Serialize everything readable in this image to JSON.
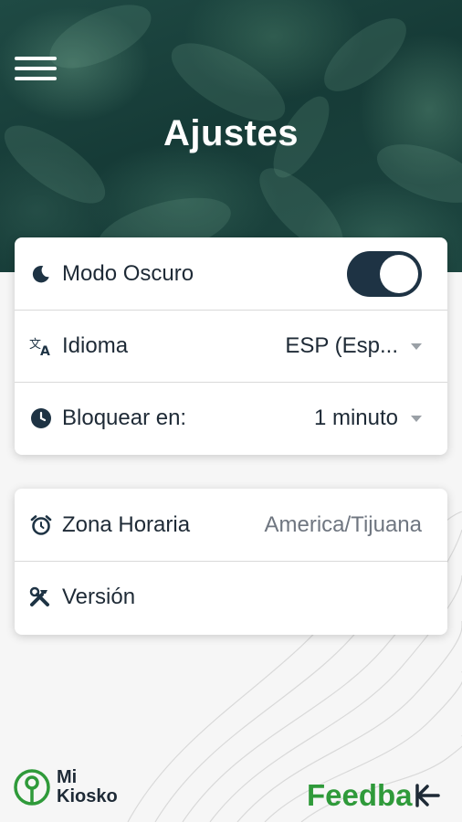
{
  "header": {
    "title": "Ajustes"
  },
  "settings_card": {
    "dark_mode": {
      "label": "Modo Oscuro",
      "enabled": true
    },
    "language": {
      "label": "Idioma",
      "value": "ESP (Esp..."
    },
    "lock": {
      "label": "Bloquear en:",
      "value": "1 minuto"
    }
  },
  "info_card": {
    "timezone": {
      "label": "Zona Horaria",
      "value": "America/Tijuana"
    },
    "version": {
      "label": "Versión",
      "value": ""
    }
  },
  "footer": {
    "logo_line1": "Mi",
    "logo_line2": "Kiosko",
    "feedback_label": "Feedba"
  },
  "colors": {
    "primary_dark": "#1e3344",
    "feedback_green": "#2f9a3a",
    "hero_green": "#163b37"
  }
}
